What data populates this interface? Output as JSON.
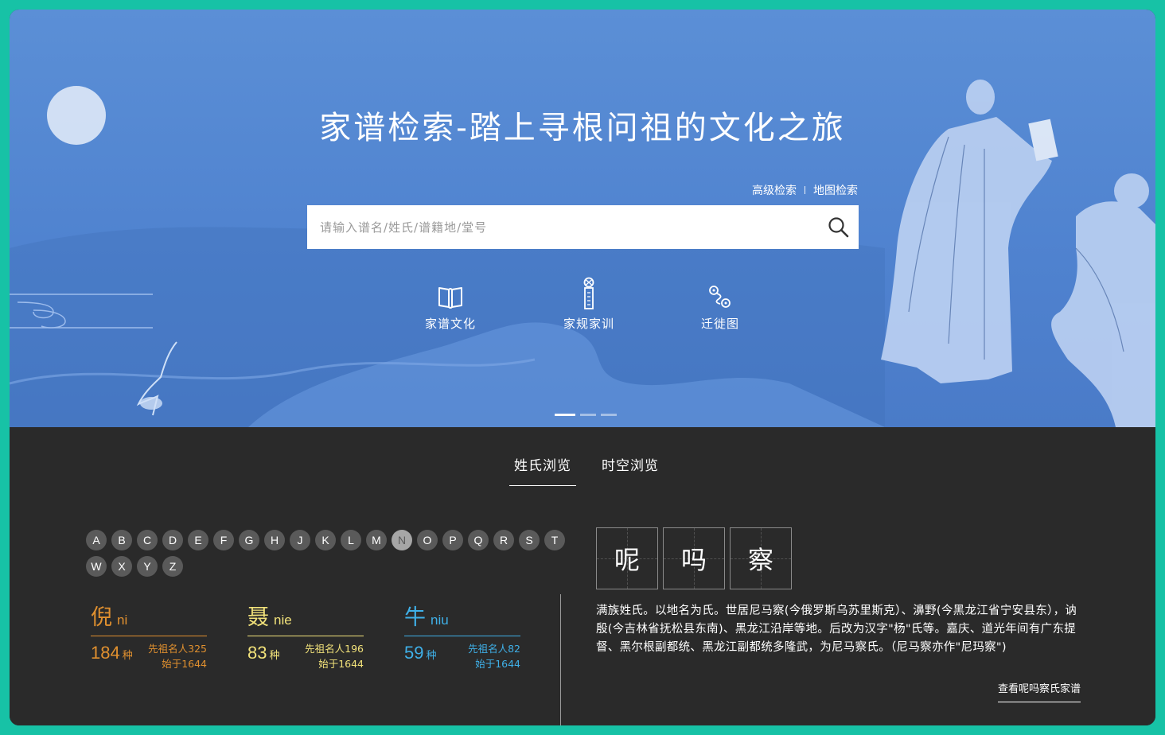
{
  "hero": {
    "title": "家谱检索-踏上寻根问祖的文化之旅",
    "links": {
      "advanced": "高级检索",
      "map": "地图检索"
    },
    "search": {
      "placeholder": "请输入谱名/姓氏/谱籍地/堂号",
      "value": ""
    },
    "quick_links": [
      {
        "label": "家谱文化",
        "icon": "book-icon"
      },
      {
        "label": "家规家训",
        "icon": "scroll-icon"
      },
      {
        "label": "迁徙图",
        "icon": "route-icon"
      }
    ],
    "carousel": {
      "slides": 3,
      "active_index": 0
    }
  },
  "browse": {
    "tabs": [
      {
        "label": "姓氏浏览",
        "active": true
      },
      {
        "label": "时空浏览",
        "active": false
      }
    ],
    "letters": [
      "A",
      "B",
      "C",
      "D",
      "E",
      "F",
      "G",
      "H",
      "J",
      "K",
      "L",
      "M",
      "N",
      "O",
      "P",
      "Q",
      "R",
      "S",
      "T",
      "W",
      "X",
      "Y",
      "Z"
    ],
    "active_letter": "N",
    "surnames": [
      {
        "char": "倪",
        "pinyin": "ni",
        "count": "184",
        "unit": "种",
        "ancestors": "先祖名人325",
        "since": "始于1644",
        "color": "#e0902f"
      },
      {
        "char": "聂",
        "pinyin": "nie",
        "count": "83",
        "unit": "种",
        "ancestors": "先祖名人196",
        "since": "始于1644",
        "color": "#f2e27a"
      },
      {
        "char": "牛",
        "pinyin": "niu",
        "count": "59",
        "unit": "种",
        "ancestors": "先祖名人82",
        "since": "始于1644",
        "color": "#3fb0e8"
      }
    ],
    "detail": {
      "chars": [
        "呢",
        "吗",
        "察"
      ],
      "description": "满族姓氏。以地名为氏。世居尼马察(今俄罗斯乌苏里斯克）、濞野(今黑龙江省宁安县东），讷殷(今吉林省抚松县东南)、黑龙江沿岸等地。后改为汉字\"杨\"氏等。嘉庆、道光年间有广东提督、黑尔根副都统、黑龙江副都统多隆武，为尼马察氏。（尼马察亦作\"尼玛察\")",
      "view_link": "查看呢吗察氏家谱"
    }
  },
  "colors": {
    "page_bg": "#17c2a6",
    "hero_bg": "#4f82cf",
    "browse_bg": "#2a2a2a"
  }
}
